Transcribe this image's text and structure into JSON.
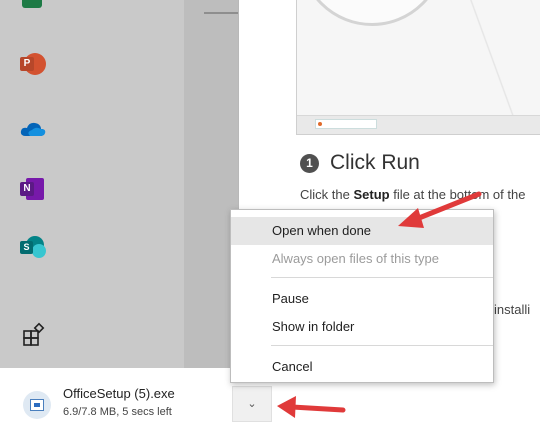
{
  "launcher": {
    "apps": [
      {
        "name": "Excel",
        "icon": "excel-icon"
      },
      {
        "name": "PowerPoint",
        "icon": "powerpoint-icon",
        "letter": "P"
      },
      {
        "name": "OneDrive",
        "icon": "onedrive-icon"
      },
      {
        "name": "OneNote",
        "icon": "onenote-icon",
        "letter": "N"
      },
      {
        "name": "SharePoint",
        "icon": "sharepoint-icon",
        "letter": "S"
      },
      {
        "name": "All apps",
        "icon": "all-apps-icon"
      }
    ]
  },
  "step": {
    "number": "1",
    "title": "Click Run",
    "desc_pre": "Click the ",
    "desc_bold": "Setup",
    "desc_post": " file at the bottom of the",
    "trailing_text": "installi"
  },
  "context_menu": {
    "items": [
      {
        "label": "Open when done",
        "state": "hover"
      },
      {
        "label": "Always open files of this type",
        "state": "disabled"
      },
      {
        "label": "Pause",
        "state": "normal"
      },
      {
        "label": "Show in folder",
        "state": "normal"
      },
      {
        "label": "Cancel",
        "state": "normal"
      }
    ]
  },
  "download": {
    "filename": "OfficeSetup (5).exe",
    "status": "6.9/7.8 MB, 5 secs left",
    "progress_fraction": 0.885,
    "chevron": "⌄"
  },
  "colors": {
    "annotation_arrow": "#e03a3a",
    "powerpoint": "#d35230",
    "onenote": "#7719aa",
    "sharepoint": "#038387",
    "onedrive": "#0364b8"
  }
}
